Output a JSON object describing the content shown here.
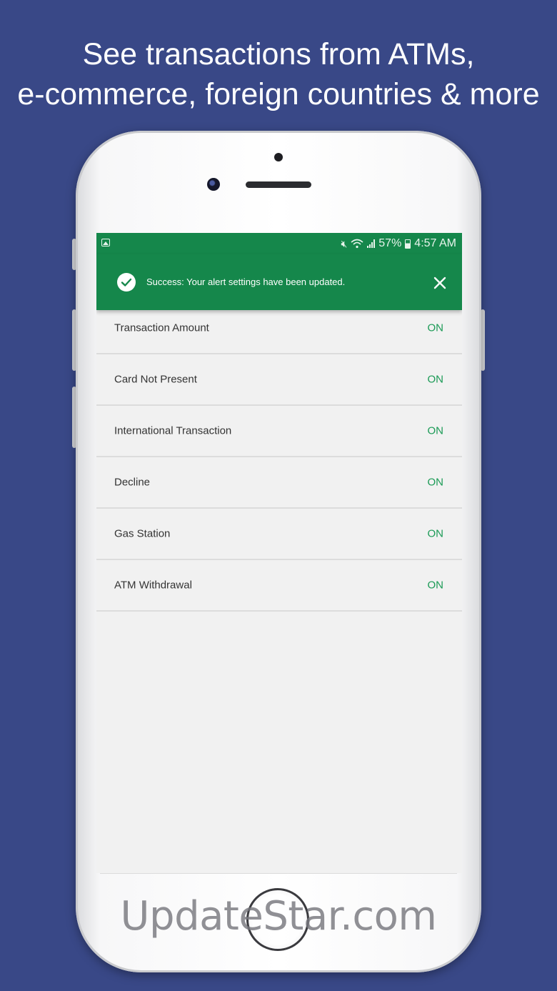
{
  "headline": {
    "line1": "See transactions from ATMs,",
    "line2": "e-commerce, foreign countries & more"
  },
  "status_bar": {
    "battery": "57%",
    "time": "4:57 AM",
    "icons": [
      "gallery-icon",
      "mute-icon",
      "wifi-icon",
      "signal-icon",
      "battery-icon"
    ]
  },
  "alert": {
    "message": "Success: Your alert settings have been updated.",
    "icon": "check-circle-icon",
    "dismiss_icon": "close-icon"
  },
  "settings": [
    {
      "label": "Transaction Amount",
      "status": "ON"
    },
    {
      "label": "Card Not Present",
      "status": "ON"
    },
    {
      "label": "International Transaction",
      "status": "ON"
    },
    {
      "label": "Decline",
      "status": "ON"
    },
    {
      "label": "Gas Station",
      "status": "ON"
    },
    {
      "label": "ATM Withdrawal",
      "status": "ON"
    }
  ],
  "watermark": "UpdateStar.com",
  "colors": {
    "background": "#394887",
    "brand_green": "#15874b",
    "status_on": "#1a9a55",
    "screen_bg": "#f1f1f1"
  }
}
